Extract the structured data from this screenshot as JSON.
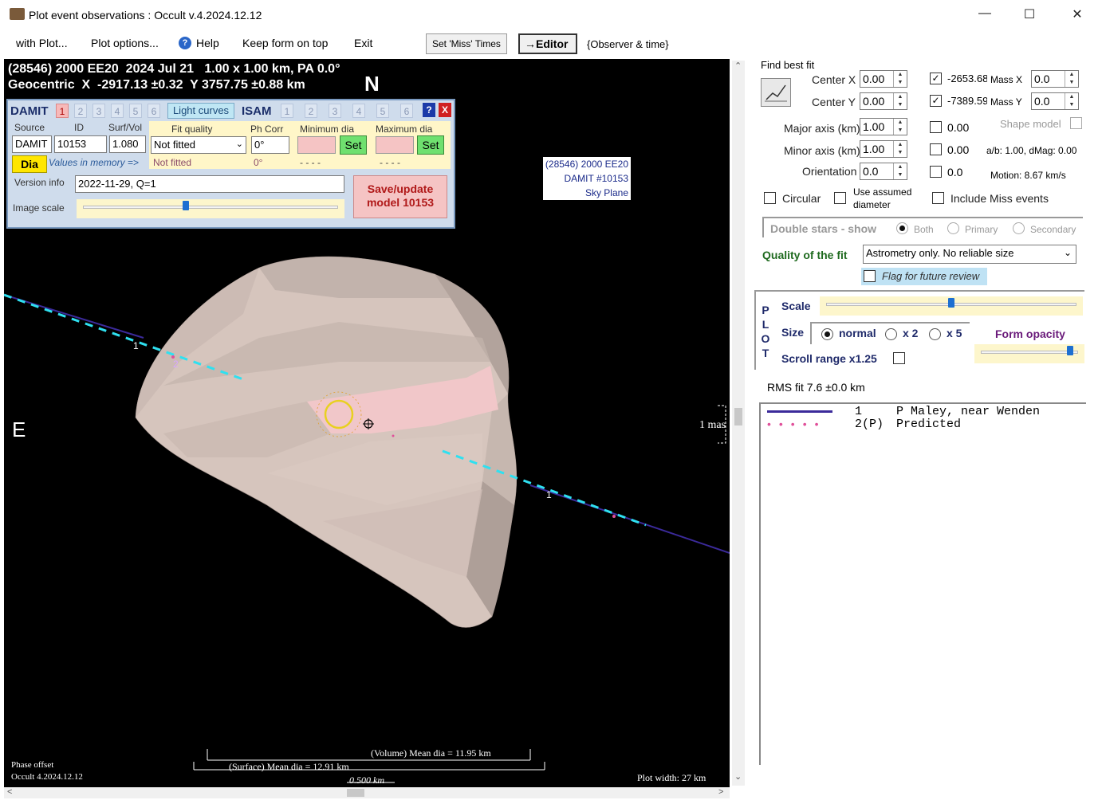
{
  "window": {
    "title": "Plot event observations : Occult v.4.2024.12.12",
    "minimize": "—",
    "maximize": "☐",
    "close": "✕"
  },
  "menu": {
    "with_plot": "with Plot...",
    "plot_options": "Plot options...",
    "help": "Help",
    "keep_on_top": "Keep form on top",
    "exit": "Exit",
    "set_miss_times": "Set 'Miss' Times",
    "editor": "→Editor",
    "observer_time": "{Observer & time}"
  },
  "plot": {
    "header_line1": "(28546) 2000 EE20  2024 Jul 21   1.00 x 1.00 km, PA 0.0°",
    "header_line2": "Geocentric  X  -2917.13 ±0.32  Y 3757.75 ±0.88 km",
    "north": "N",
    "east": "E",
    "sky_label": [
      "(28546) 2000 EE20",
      "DAMIT #10153",
      "Sky Plane"
    ],
    "chord1_label_a": "1",
    "chord1_label_b": "1",
    "chord2_label": "2",
    "mas_label": "1 mas",
    "volume_mean": "(Volume) Mean dia = 11.95 km",
    "surface_mean": "(Surface) Mean dia = 12.91 km",
    "scale_label": "0.500 km",
    "phase_offset": "Phase offset",
    "occult_version": "Occult 4.2024.12.12",
    "plot_width": "Plot width: 27 km"
  },
  "damit": {
    "title": "DAMIT",
    "tabs": [
      "1",
      "2",
      "3",
      "4",
      "5",
      "6"
    ],
    "light_curves": "Light curves",
    "isam": "ISAM",
    "isam_tabs": [
      "1",
      "2",
      "3",
      "4",
      "5",
      "6"
    ],
    "help_btn": "?",
    "close_btn": "X",
    "source_hdr": "Source",
    "id_hdr": "ID",
    "surf_hdr": "Surf/Vol",
    "source_val": "DAMIT",
    "id_val": "10153",
    "surf_val": "1.080",
    "fit_quality_hdr": "Fit quality",
    "fit_quality_val": "Not fitted",
    "fit_quality_mem": "Not fitted",
    "ph_corr_hdr": "Ph Corr",
    "ph_corr_val": "0°",
    "ph_corr_mem": "0°",
    "min_dia_hdr": "Minimum dia",
    "max_dia_hdr": "Maximum dia",
    "min_mem": "- - - -",
    "max_mem": "- - - -",
    "set": "Set",
    "dia_btn": "Dia",
    "values_in_memory": "Values in memory =>",
    "version_info_lbl": "Version info",
    "version_info_val": "2022-11-29, Q=1",
    "image_scale_lbl": "Image scale",
    "image_scale_fraction": 0.4,
    "save_update": "Save/update",
    "save_update_model": "model  10153"
  },
  "right": {
    "find_best_fit": "Find best fit",
    "center_x_lbl": "Center X",
    "center_x_val": "0.00",
    "center_y_lbl": "Center Y",
    "center_y_val": "0.00",
    "cx_check_val": "-2653.68",
    "cy_check_val": "-7389.59",
    "mass_x_lbl": "Mass X",
    "mass_x_val": "0.0",
    "mass_y_lbl": "Mass Y",
    "mass_y_val": "0.0",
    "major_lbl": "Major axis (km)",
    "major_val": "1.00",
    "major_chk_val": "0.00",
    "minor_lbl": "Minor axis (km)",
    "minor_val": "1.00",
    "minor_chk_val": "0.00",
    "orient_lbl": "Orientation",
    "orient_val": "0.0",
    "orient_chk_val": "0.0",
    "shape_model": "Shape model",
    "ab_dmag": "a/b: 1.00, dMag: 0.00",
    "motion": "Motion: 8.67 km/s",
    "circular": "Circular",
    "use_assumed": "Use assumed",
    "diameter": "diameter",
    "include_miss": "Include Miss events",
    "double_stars": "Double stars - show",
    "both": "Both",
    "primary": "Primary",
    "secondary": "Secondary",
    "quality_lbl": "Quality of the fit",
    "quality_val": "Astrometry only. No reliable size",
    "flag_review": "Flag for future review",
    "plot_vertical": [
      "P",
      "L",
      "O",
      "T"
    ],
    "scale_lbl": "Scale",
    "scale_fraction": 0.5,
    "size_lbl": "Size",
    "size_normal": "normal",
    "size_x2": "x 2",
    "size_x5": "x 5",
    "form_opacity": "Form opacity",
    "opacity_fraction": 0.95,
    "scroll_range": "Scroll range x1.25",
    "rms_fit": "RMS fit 7.6 ±0.0 km"
  },
  "legend": {
    "rows": [
      {
        "num": "1",
        "name": "P Maley, near Wenden"
      },
      {
        "num": "2(P)",
        "name": "Predicted"
      }
    ]
  },
  "colors": {
    "chord_observed": "#3b2a9a",
    "chord_predicted": "#e0509a",
    "accent_cyan": "#2fe0f0",
    "asteroid_body": "#d6c5bd"
  }
}
